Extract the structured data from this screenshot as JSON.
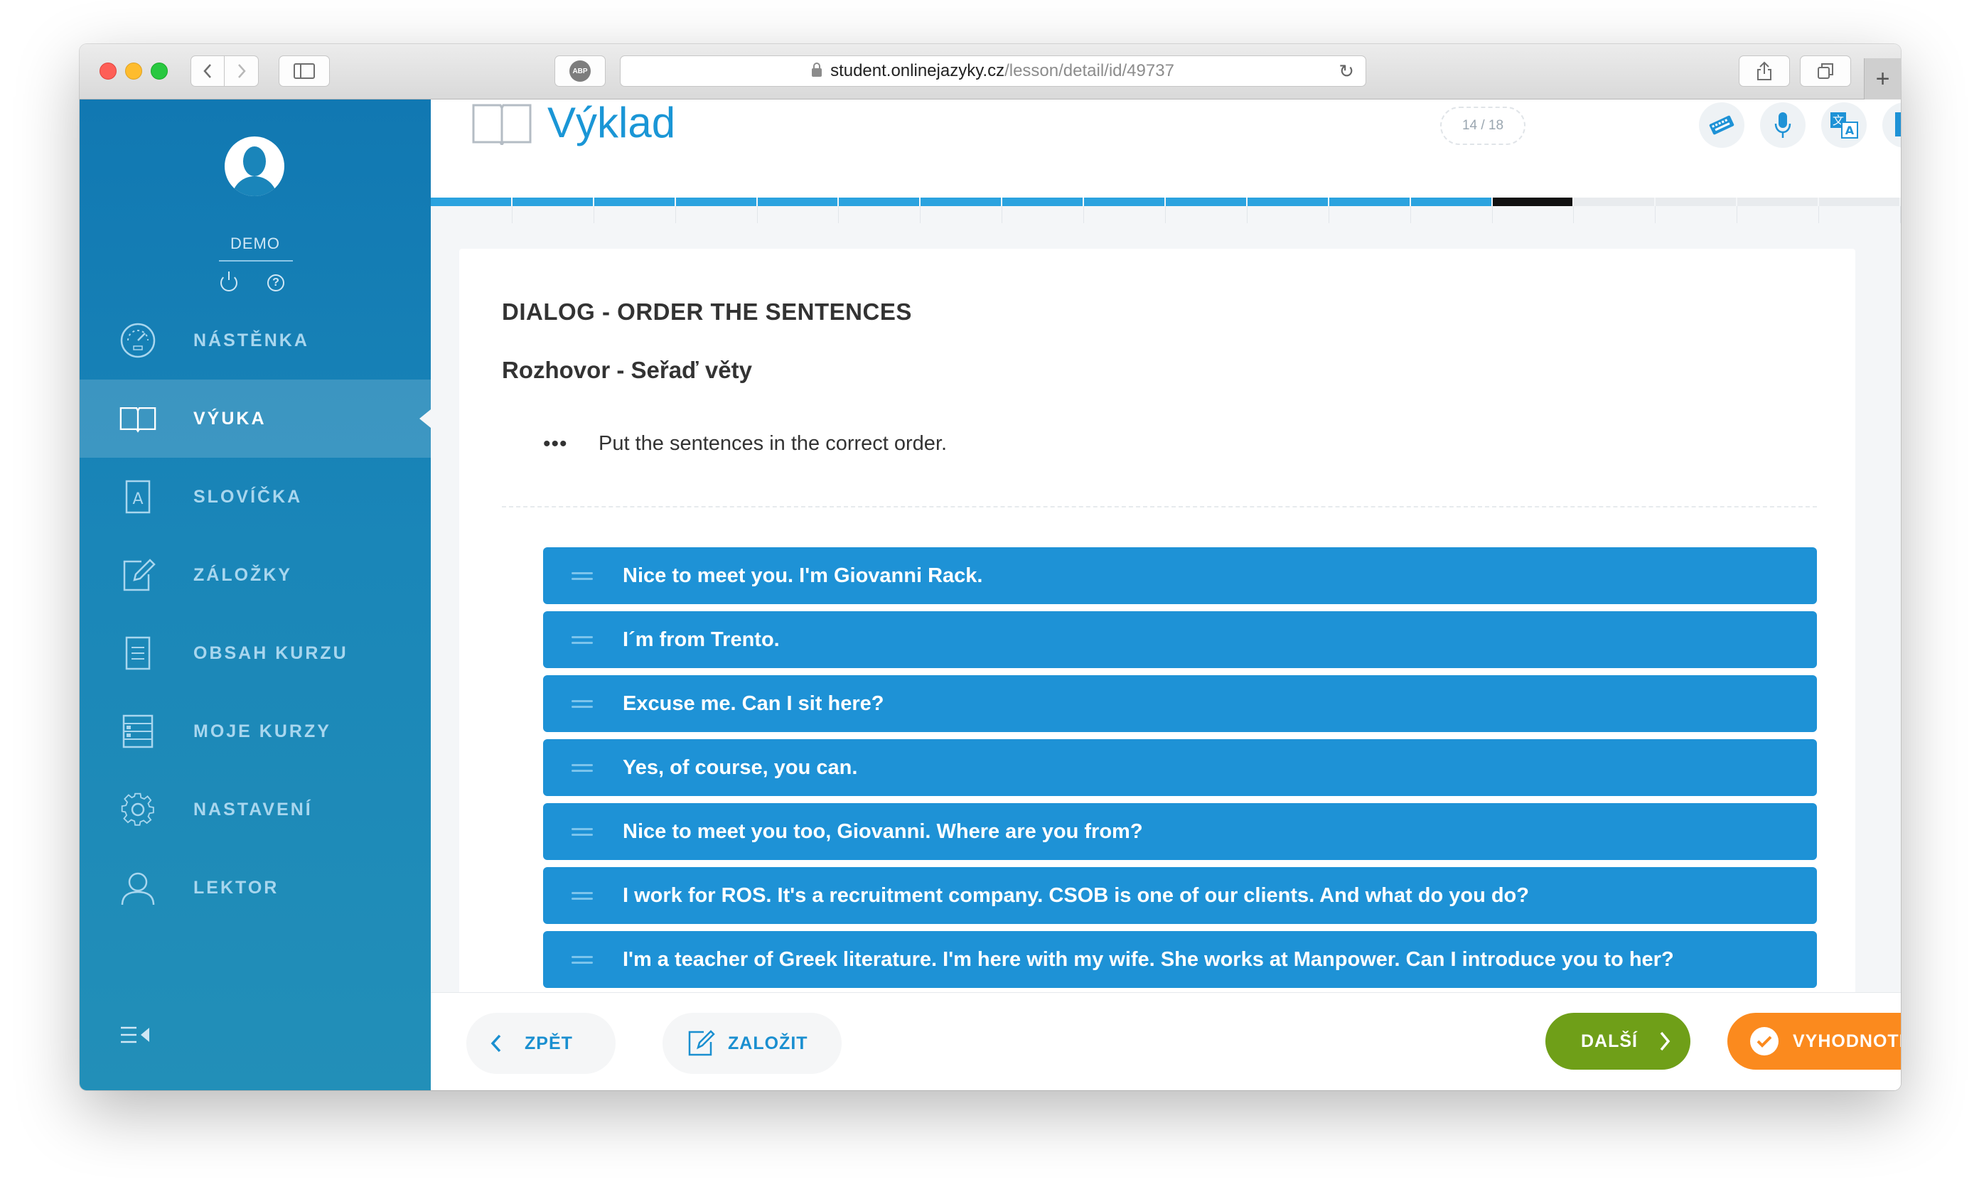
{
  "browser": {
    "url_host": "student.onlinejazyky.cz",
    "url_path": "/lesson/detail/id/49737",
    "adblock_label": "ABP"
  },
  "sidebar": {
    "username": "DEMO",
    "items": [
      {
        "label": "NÁSTĚNKA",
        "icon": "dashboard-icon",
        "active": false
      },
      {
        "label": "VÝUKA",
        "icon": "book-icon",
        "active": true
      },
      {
        "label": "SLOVÍČKA",
        "icon": "dictionary-icon",
        "active": false
      },
      {
        "label": "ZÁLOŽKY",
        "icon": "edit-note-icon",
        "active": false
      },
      {
        "label": "OBSAH KURZU",
        "icon": "document-icon",
        "active": false
      },
      {
        "label": "MOJE KURZY",
        "icon": "list-icon",
        "active": false
      },
      {
        "label": "NASTAVENÍ",
        "icon": "gear-icon",
        "active": false
      },
      {
        "label": "LEKTOR",
        "icon": "user-icon",
        "active": false
      }
    ]
  },
  "header": {
    "title": "Výklad",
    "counter": "14 / 18",
    "tools": [
      "keyboard-icon",
      "microphone-icon",
      "translate-icon",
      "add-document-icon"
    ]
  },
  "progress": {
    "current": 14,
    "total": 18
  },
  "exercise": {
    "heading": "DIALOG - ORDER THE SENTENCES",
    "subheading": "Rozhovor - Seřaď věty",
    "instruction": "Put the sentences in the correct order.",
    "sentences": [
      "Nice to meet you. I'm Giovanni Rack.",
      "I´m from Trento.",
      "Excuse me. Can I sit here?",
      "Yes, of course, you can.",
      "Nice to meet you too, Giovanni. Where are you from?",
      "I work for ROS. It's a recruitment company. CSOB is one of our clients. And what do you do?",
      "I'm a teacher of Greek literature. I'm here with my wife. She works at Manpower. Can I introduce you to her?"
    ]
  },
  "footer": {
    "back_label": "ZPĚT",
    "bookmark_label": "ZALOŽIT",
    "next_label": "DALŠÍ",
    "evaluate_label": "VYHODNOTIT"
  },
  "colors": {
    "sidebar": "#1a86b8",
    "accent": "#1e92d6",
    "next": "#6f9f18",
    "evaluate": "#fb8a1e"
  }
}
